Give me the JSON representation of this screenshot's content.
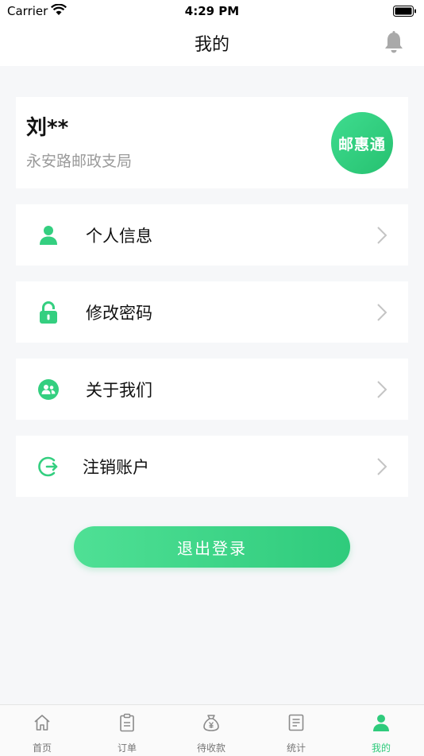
{
  "status_bar": {
    "carrier": "Carrier",
    "time": "4:29 PM"
  },
  "nav": {
    "title": "我的"
  },
  "profile": {
    "name": "刘**",
    "organization": "永安路邮政支局",
    "logo_text": "邮惠通"
  },
  "menu": {
    "items": [
      {
        "label": "个人信息",
        "icon": "person-icon"
      },
      {
        "label": "修改密码",
        "icon": "lock-icon"
      },
      {
        "label": "关于我们",
        "icon": "group-icon"
      },
      {
        "label": "注销账户",
        "icon": "logout-circle-icon"
      }
    ]
  },
  "logout_button": {
    "label": "退出登录"
  },
  "tabs": [
    {
      "label": "首页",
      "icon": "home-icon",
      "active": false
    },
    {
      "label": "订单",
      "icon": "clipboard-icon",
      "active": false
    },
    {
      "label": "待收款",
      "icon": "money-bag-icon",
      "active": false
    },
    {
      "label": "统计",
      "icon": "document-icon",
      "active": false
    },
    {
      "label": "我的",
      "icon": "person-icon",
      "active": true
    }
  ],
  "colors": {
    "accent": "#2fcb7c",
    "background": "#f6f7f9",
    "inactive_tab": "#777777"
  }
}
